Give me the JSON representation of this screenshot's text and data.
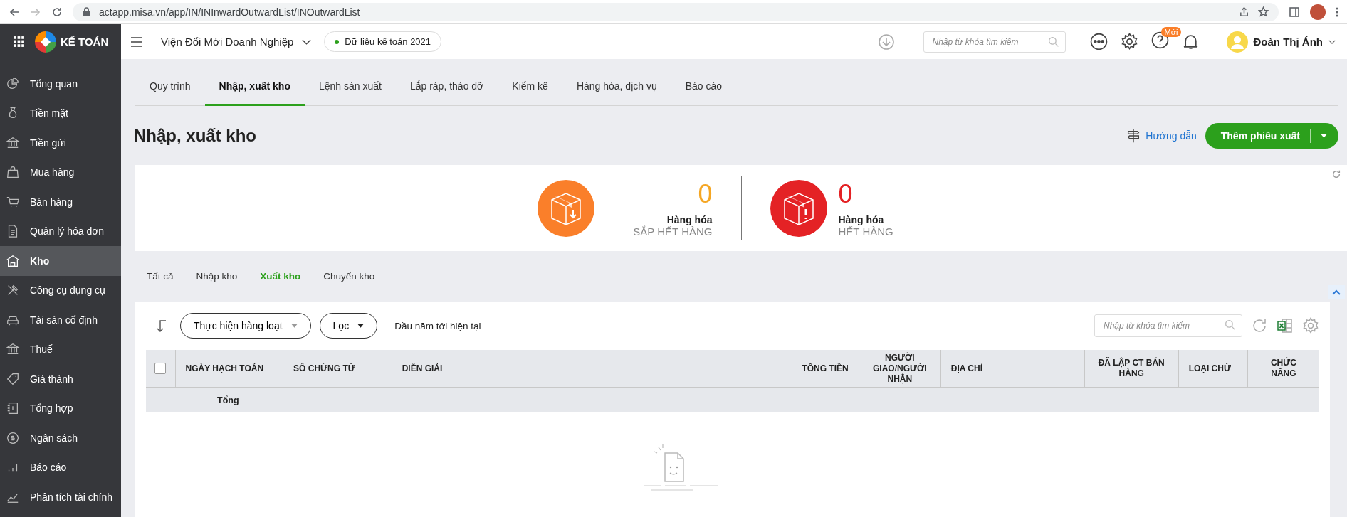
{
  "browser": {
    "url": "actapp.misa.vn/app/IN/INInwardOutwardList/INOutwardList"
  },
  "app_header": {
    "logo_text": "KẾ TOÁN",
    "company": "Viện Đổi Mới Doanh Nghiệp",
    "data_badge": "Dữ liệu kế toán 2021",
    "search": {
      "placeholder": "Nhập từ khóa tìm kiếm"
    },
    "help_badge": "Mới",
    "user_name": "Đoàn Thị Ánh"
  },
  "sidebar": {
    "items": [
      {
        "label": "Tổng quan",
        "selected": false
      },
      {
        "label": "Tiền mặt",
        "selected": false
      },
      {
        "label": "Tiền gửi",
        "selected": false
      },
      {
        "label": "Mua hàng",
        "selected": false
      },
      {
        "label": "Bán hàng",
        "selected": false
      },
      {
        "label": "Quản lý hóa đơn",
        "selected": false
      },
      {
        "label": "Kho",
        "selected": true
      },
      {
        "label": "Công cụ dụng cụ",
        "selected": false
      },
      {
        "label": "Tài sản cố định",
        "selected": false
      },
      {
        "label": "Thuế",
        "selected": false
      },
      {
        "label": "Giá thành",
        "selected": false
      },
      {
        "label": "Tổng hợp",
        "selected": false
      },
      {
        "label": "Ngân sách",
        "selected": false
      },
      {
        "label": "Báo cáo",
        "selected": false
      },
      {
        "label": "Phân tích tài chính",
        "selected": false
      }
    ]
  },
  "module_tabs": [
    {
      "label": "Quy trình",
      "selected": false
    },
    {
      "label": "Nhập, xuất kho",
      "selected": true
    },
    {
      "label": "Lệnh sản xuất",
      "selected": false
    },
    {
      "label": "Lắp ráp, tháo dỡ",
      "selected": false
    },
    {
      "label": "Kiểm kê",
      "selected": false
    },
    {
      "label": "Hàng hóa, dịch vụ",
      "selected": false
    },
    {
      "label": "Báo cáo",
      "selected": false
    }
  ],
  "page": {
    "title": "Nhập, xuất kho",
    "guide_link": "Hướng dẫn",
    "primary_button": "Thêm phiếu xuất"
  },
  "summary": {
    "cards": [
      {
        "kind": "warning",
        "value": "0",
        "label": "Hàng hóa",
        "status": "SẮP HẾT HÀNG"
      },
      {
        "kind": "danger",
        "value": "0",
        "label": "Hàng hóa",
        "status": "HẾT HÀNG"
      }
    ]
  },
  "sub_tabs": [
    {
      "label": "Tất cả",
      "selected": false
    },
    {
      "label": "Nhập kho",
      "selected": false
    },
    {
      "label": "Xuất kho",
      "selected": true
    },
    {
      "label": "Chuyển kho",
      "selected": false
    }
  ],
  "toolbar": {
    "bulk_button": "Thực hiện hàng loạt",
    "filter_button": "Lọc",
    "period": "Đầu năm tới hiện tại",
    "search": {
      "placeholder": "Nhập từ khóa tìm kiếm"
    }
  },
  "table": {
    "select_all_checked": false,
    "columns": [
      {
        "label": "NGÀY HẠCH TOÁN"
      },
      {
        "label": "SỐ CHỨNG TỪ"
      },
      {
        "label": "DIỄN GIẢI"
      },
      {
        "label": "TỔNG TIỀN"
      },
      {
        "label": "NGƯỜI GIAO/NGƯỜI NHẬN"
      },
      {
        "label": "ĐỊA CHỈ"
      },
      {
        "label": "ĐÃ LẬP CT BÁN HÀNG"
      },
      {
        "label": "LOẠI CHỨ"
      },
      {
        "label": "CHỨC NĂNG"
      }
    ],
    "total_label": "Tổng"
  }
}
